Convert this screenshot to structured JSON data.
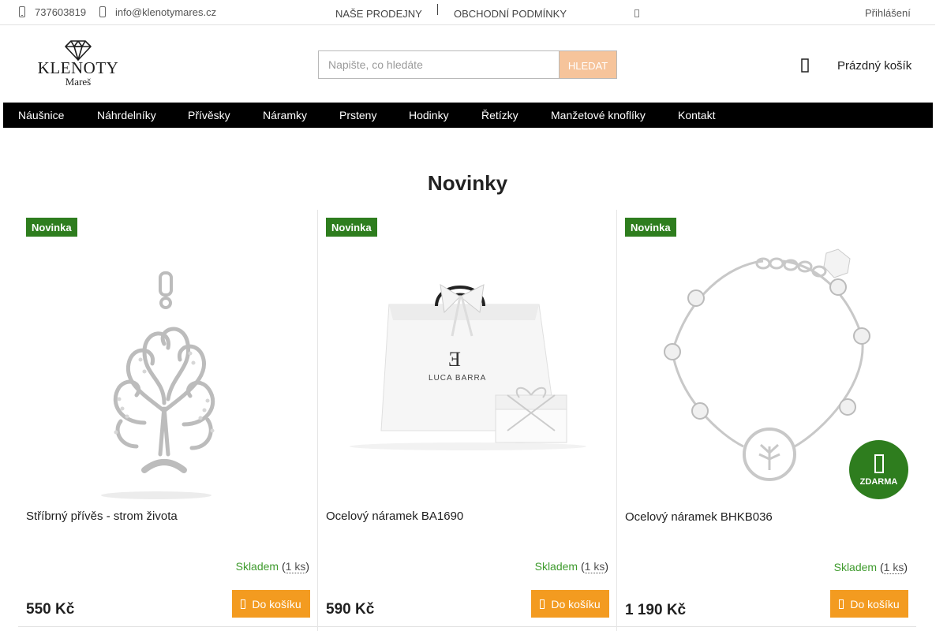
{
  "topbar": {
    "phone": "737603819",
    "email": "info@klenotymares.cz",
    "links": [
      "NAŠE PRODEJNY",
      "OBCHODNÍ PODMÍNKY"
    ],
    "login": "Přihlášení"
  },
  "logo": {
    "line1": "KLENOTY",
    "line2": "Mareš"
  },
  "search": {
    "placeholder": "Napište, co hledáte",
    "button": "HLEDAT"
  },
  "cart": {
    "label": "Prázdný košík",
    "icon": "cart-icon"
  },
  "menu": [
    "Náušnice",
    "Náhrdelníky",
    "Přívěsky",
    "Náramky",
    "Prsteny",
    "Hodinky",
    "Řetízky",
    "Manžetové knoflíky",
    "Kontakt"
  ],
  "section": {
    "title": "Novinky"
  },
  "products": [
    {
      "badge": "Novinka",
      "name": "Stříbrný přívěs - strom života",
      "stock": "Skladem",
      "qty": "1 ks",
      "price": "550 Kč",
      "button": "Do košíku"
    },
    {
      "badge": "Novinka",
      "name": "Ocelový náramek BA1690",
      "stock": "Skladem",
      "qty": "1 ks",
      "price": "590 Kč",
      "button": "Do košíku"
    },
    {
      "badge": "Novinka",
      "name": "Ocelový náramek BHKB036",
      "stock": "Skladem",
      "qty": "1 ks",
      "price": "1 190 Kč",
      "button": "Do košíku",
      "free_label": "ZDARMA"
    }
  ],
  "colors": {
    "badge": "#2e7d1e",
    "stock": "#3f9b2e",
    "add_button": "#f39b20",
    "search_button": "#f6c49b",
    "menu_bg": "#000000"
  }
}
